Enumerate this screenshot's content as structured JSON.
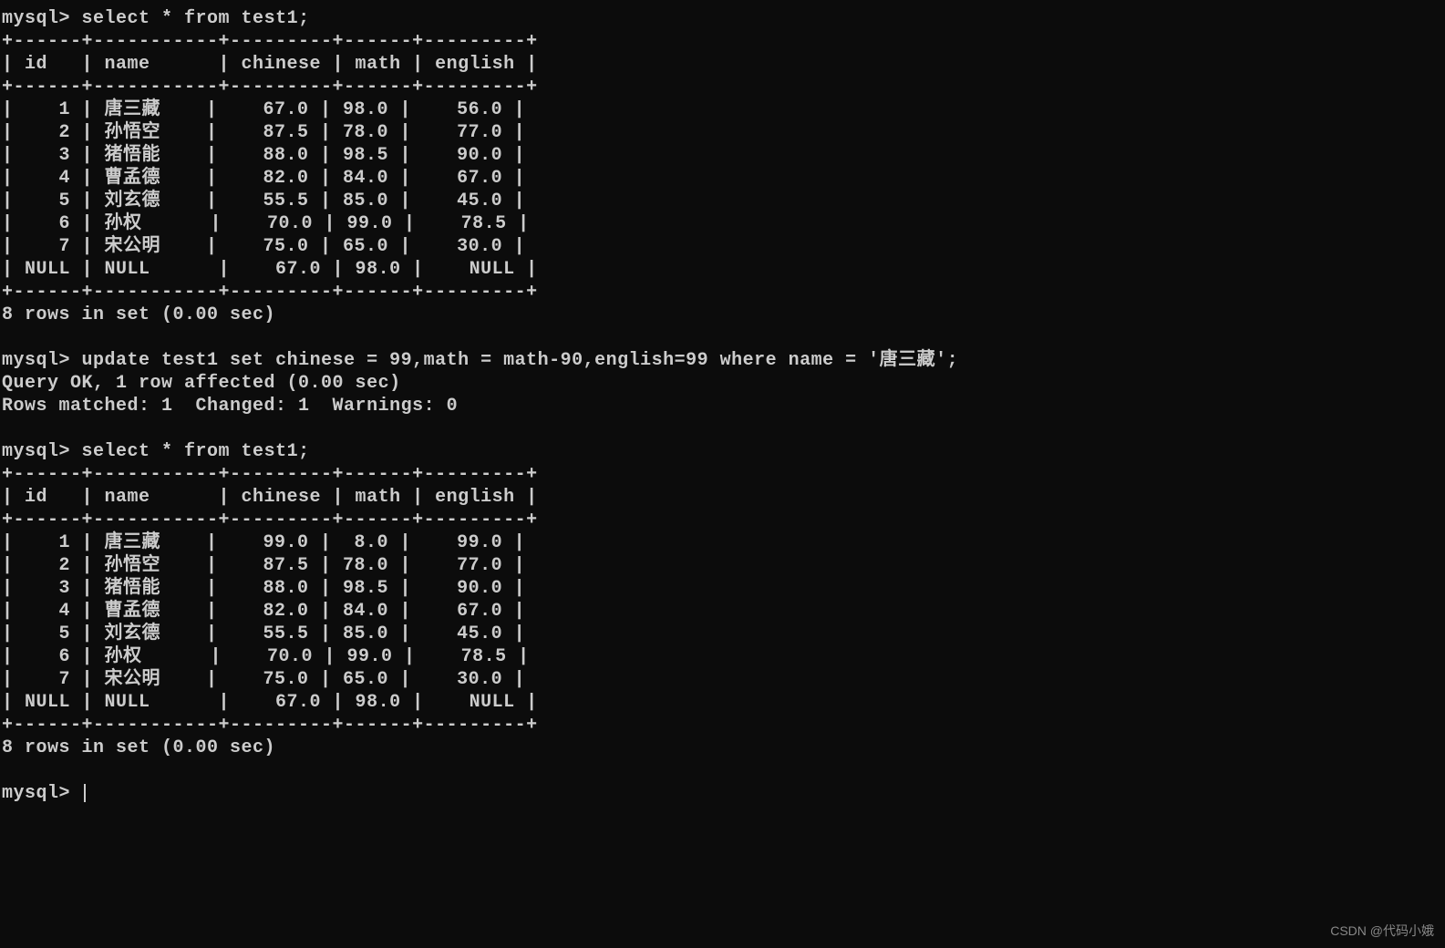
{
  "prompt": "mysql>",
  "queries": {
    "select1": "select * from test1;",
    "update": "update test1 set chinese = 99,math = math-90,english=99 where name = '唐三藏';",
    "select2": "select * from test1;"
  },
  "update_result": {
    "line1": "Query OK, 1 row affected (0.00 sec)",
    "line2": "Rows matched: 1  Changed: 1  Warnings: 0"
  },
  "table_border": "+------+-----------+---------+------+---------+",
  "table_header": "| id   | name      | chinese | math | english |",
  "rows_status": "8 rows in set (0.00 sec)",
  "table1": {
    "columns": [
      "id",
      "name",
      "chinese",
      "math",
      "english"
    ],
    "rows": [
      {
        "id": "1",
        "name": "唐三藏",
        "chinese": "67.0",
        "math": "98.0",
        "english": "56.0"
      },
      {
        "id": "2",
        "name": "孙悟空",
        "chinese": "87.5",
        "math": "78.0",
        "english": "77.0"
      },
      {
        "id": "3",
        "name": "猪悟能",
        "chinese": "88.0",
        "math": "98.5",
        "english": "90.0"
      },
      {
        "id": "4",
        "name": "曹孟德",
        "chinese": "82.0",
        "math": "84.0",
        "english": "67.0"
      },
      {
        "id": "5",
        "name": "刘玄德",
        "chinese": "55.5",
        "math": "85.0",
        "english": "45.0"
      },
      {
        "id": "6",
        "name": "孙权",
        "chinese": "70.0",
        "math": "99.0",
        "english": "78.5"
      },
      {
        "id": "7",
        "name": "宋公明",
        "chinese": "75.0",
        "math": "65.0",
        "english": "30.0"
      },
      {
        "id": "NULL",
        "name": "NULL",
        "chinese": "67.0",
        "math": "98.0",
        "english": "NULL"
      }
    ]
  },
  "table2": {
    "columns": [
      "id",
      "name",
      "chinese",
      "math",
      "english"
    ],
    "rows": [
      {
        "id": "1",
        "name": "唐三藏",
        "chinese": "99.0",
        "math": "8.0",
        "english": "99.0"
      },
      {
        "id": "2",
        "name": "孙悟空",
        "chinese": "87.5",
        "math": "78.0",
        "english": "77.0"
      },
      {
        "id": "3",
        "name": "猪悟能",
        "chinese": "88.0",
        "math": "98.5",
        "english": "90.0"
      },
      {
        "id": "4",
        "name": "曹孟德",
        "chinese": "82.0",
        "math": "84.0",
        "english": "67.0"
      },
      {
        "id": "5",
        "name": "刘玄德",
        "chinese": "55.5",
        "math": "85.0",
        "english": "45.0"
      },
      {
        "id": "6",
        "name": "孙权",
        "chinese": "70.0",
        "math": "99.0",
        "english": "78.5"
      },
      {
        "id": "7",
        "name": "宋公明",
        "chinese": "75.0",
        "math": "65.0",
        "english": "30.0"
      },
      {
        "id": "NULL",
        "name": "NULL",
        "chinese": "67.0",
        "math": "98.0",
        "english": "NULL"
      }
    ]
  },
  "watermark": "CSDN @代码小娥"
}
